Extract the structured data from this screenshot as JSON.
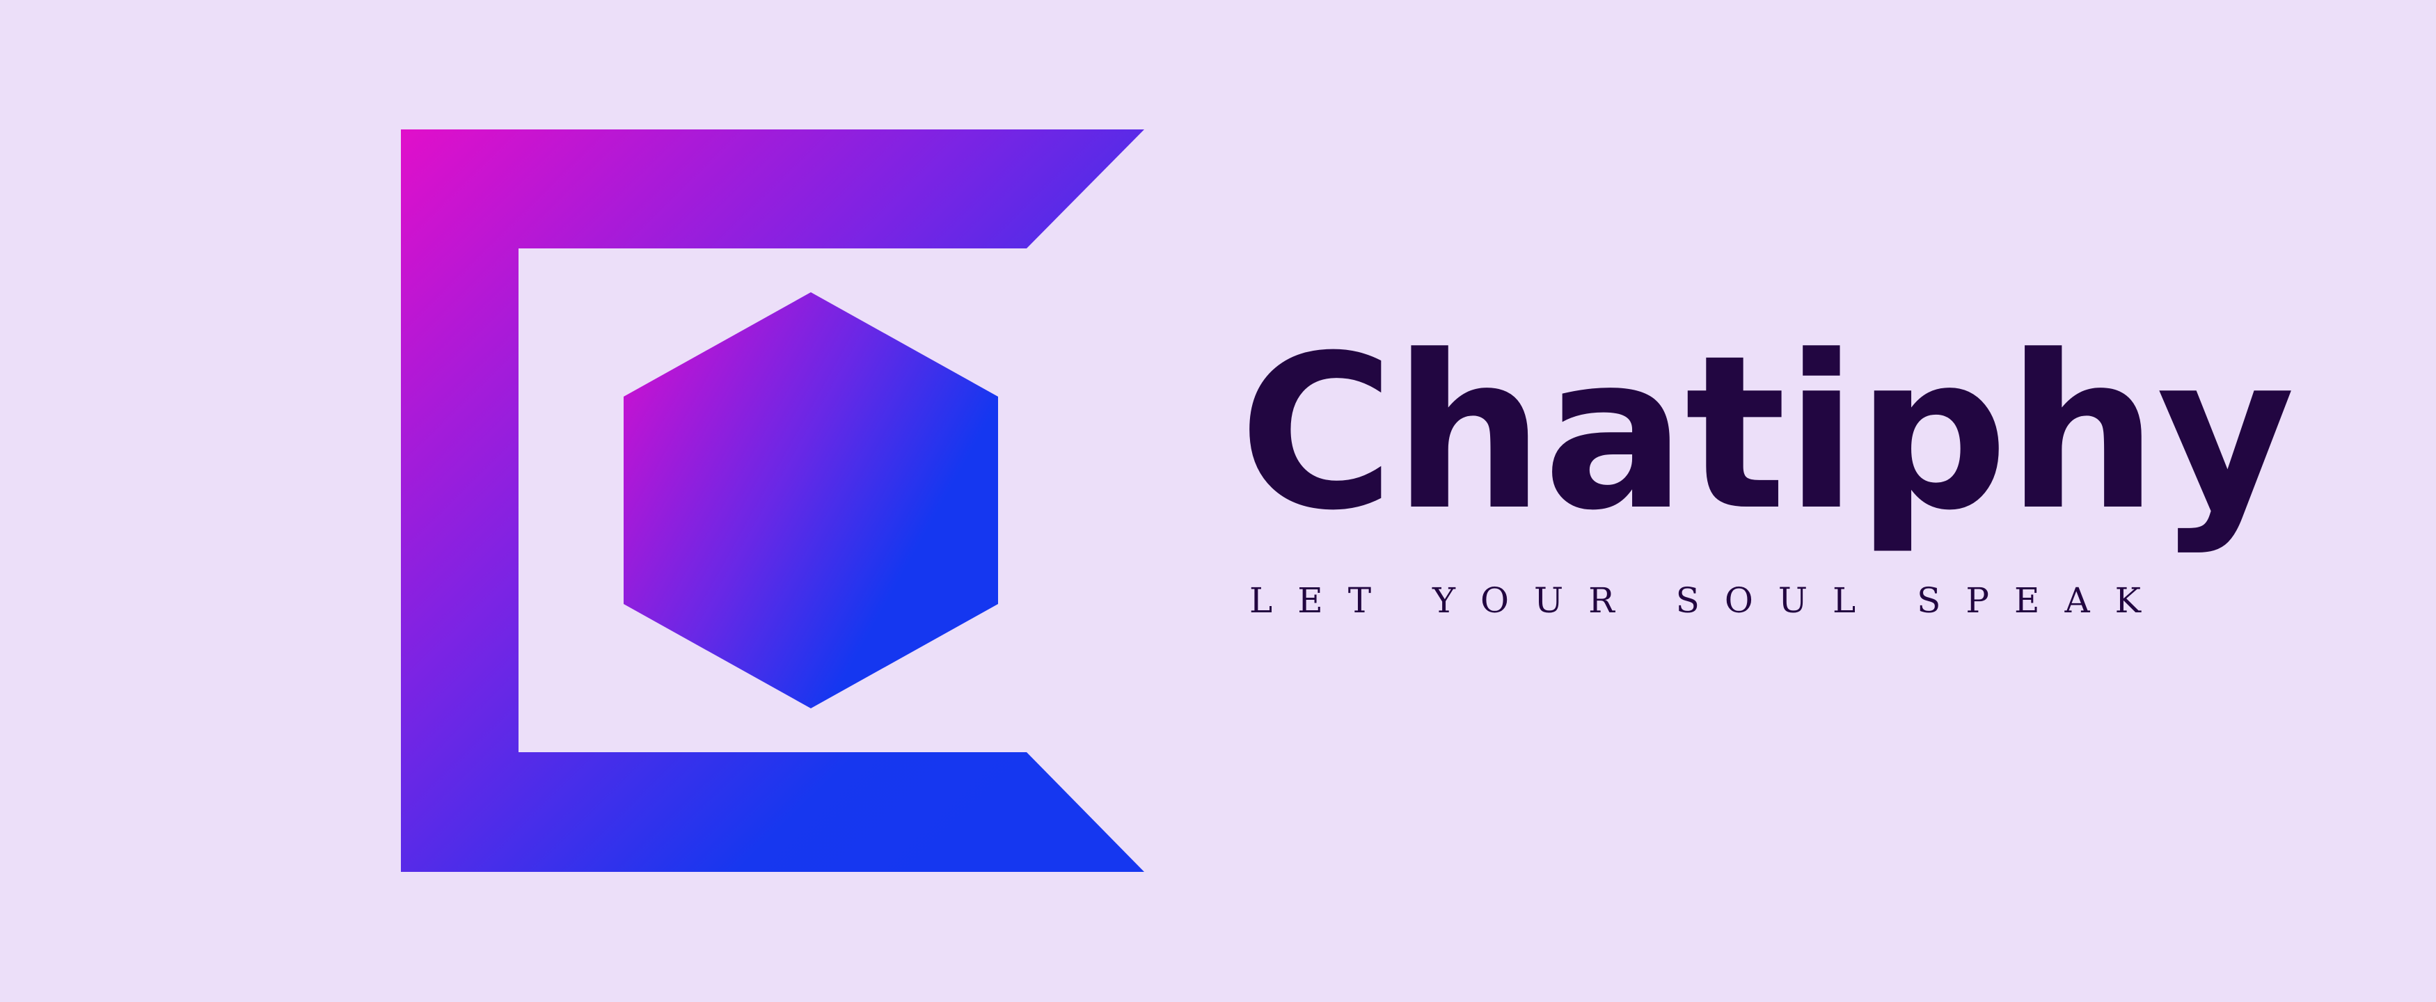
{
  "logo": {
    "mark_shape": "bracket-c-with-hexagon",
    "gradient_start": "#e10fca",
    "gradient_mid": "#7a24e4",
    "gradient_end": "#1537f0",
    "background": "#ecdff9",
    "text_color": "#220641"
  },
  "brand": {
    "name": "Chatiphy",
    "tagline": "LET YOUR SOUL SPEAK"
  }
}
